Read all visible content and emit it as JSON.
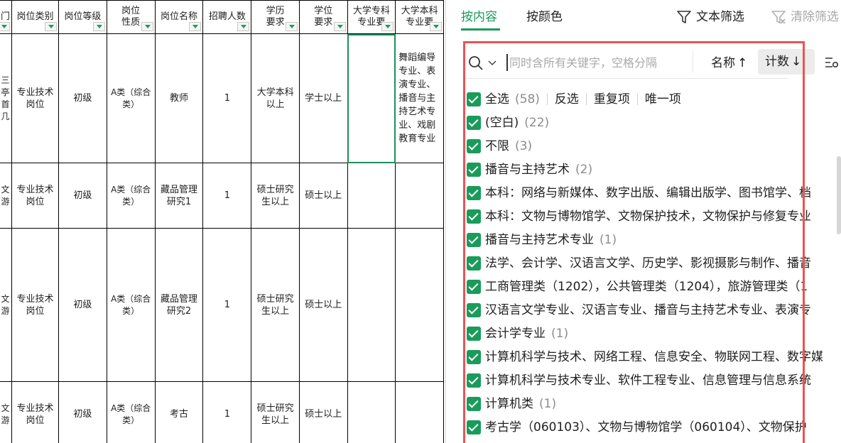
{
  "sheet": {
    "headers": [
      "门",
      "岗位类别",
      "岗位等级",
      "岗位\n性质",
      "岗位名称",
      "招聘人数",
      "学历\n要求",
      "学位\n要求",
      "大学专科\n专业要",
      "大学本科\n专业要"
    ],
    "rows": [
      {
        "first": "三\n亭\n首\n几",
        "category": "专业技术\n岗位",
        "level": "初级",
        "nature": "A类（综合\n类）",
        "name": "教师",
        "count": "1",
        "education": "大学本科\n以上",
        "degree": "学士以上",
        "college": "",
        "bachelor": "舞蹈编导\n专业、表\n演专业、\n播音与主\n持艺术专\n业、戏剧\n教育专业"
      },
      {
        "first": "文\n游",
        "category": "专业技术\n岗位",
        "level": "初级",
        "nature": "A类（综合\n类）",
        "name": "藏品管理\n研究1",
        "count": "1",
        "education": "硕士研究\n生以上",
        "degree": "硕士以上",
        "college": "",
        "bachelor": ""
      },
      {
        "first": "文\n游",
        "category": "专业技术\n岗位",
        "level": "初级",
        "nature": "A类（综合\n类）",
        "name": "藏品管理\n研究2",
        "count": "1",
        "education": "硕士研究\n生以上",
        "degree": "硕士以上",
        "college": "",
        "bachelor": ""
      },
      {
        "first": "文\n游",
        "category": "专业技术\n岗位",
        "level": "初级",
        "nature": "A类（综合\n类）",
        "name": "考古",
        "count": "1",
        "education": "硕士研究\n生以上",
        "degree": "硕士以上",
        "college": "",
        "bachelor": ""
      }
    ]
  },
  "panel": {
    "tabs": [
      "按内容",
      "按颜色"
    ],
    "text_filter": "文本筛选",
    "clear_filter": "清除筛选",
    "search_placeholder": "同时含所有关键字，空格分隔",
    "sort_name": "名称",
    "sort_count": "计数",
    "select_all": "全选",
    "select_all_count": "(58)",
    "invert": "反选",
    "duplicates": "重复项",
    "unique": "唯一项",
    "items": [
      {
        "label": "(空白)",
        "count": "(22)"
      },
      {
        "label": "不限",
        "count": "(3)"
      },
      {
        "label": "播音与主持艺术",
        "count": "(2)"
      },
      {
        "label": "本科：网络与新媒体、数字出版、编辑出版学、图书馆学、档",
        "count": ""
      },
      {
        "label": "本科：文物与博物馆学、文物保护技术，文物保护与修复专业",
        "count": ""
      },
      {
        "label": "播音与主持艺术专业",
        "count": "(1)"
      },
      {
        "label": "法学、会计学、汉语言文学、历史学、影视摄影与制作、播音",
        "count": ""
      },
      {
        "label": "工商管理类（1202），公共管理类（1204），旅游管理类（1",
        "count": ""
      },
      {
        "label": "汉语言文学专业、汉语言专业、播音与主持艺术专业、表演专",
        "count": ""
      },
      {
        "label": "会计学专业",
        "count": "(1)"
      },
      {
        "label": "计算机科学与技术、网络工程、信息安全、物联网工程、数字媒",
        "count": ""
      },
      {
        "label": "计算机科学与技术专业、软件工程专业、信息管理与信息系统",
        "count": ""
      },
      {
        "label": "计算机类",
        "count": "(1)"
      },
      {
        "label": "考古学（060103）、文物与博物馆学（060104）、文物保护",
        "count": ""
      }
    ]
  },
  "colors": {
    "accent": "#1a9b5a",
    "highlight": "#e65556",
    "grid": "#000000"
  }
}
